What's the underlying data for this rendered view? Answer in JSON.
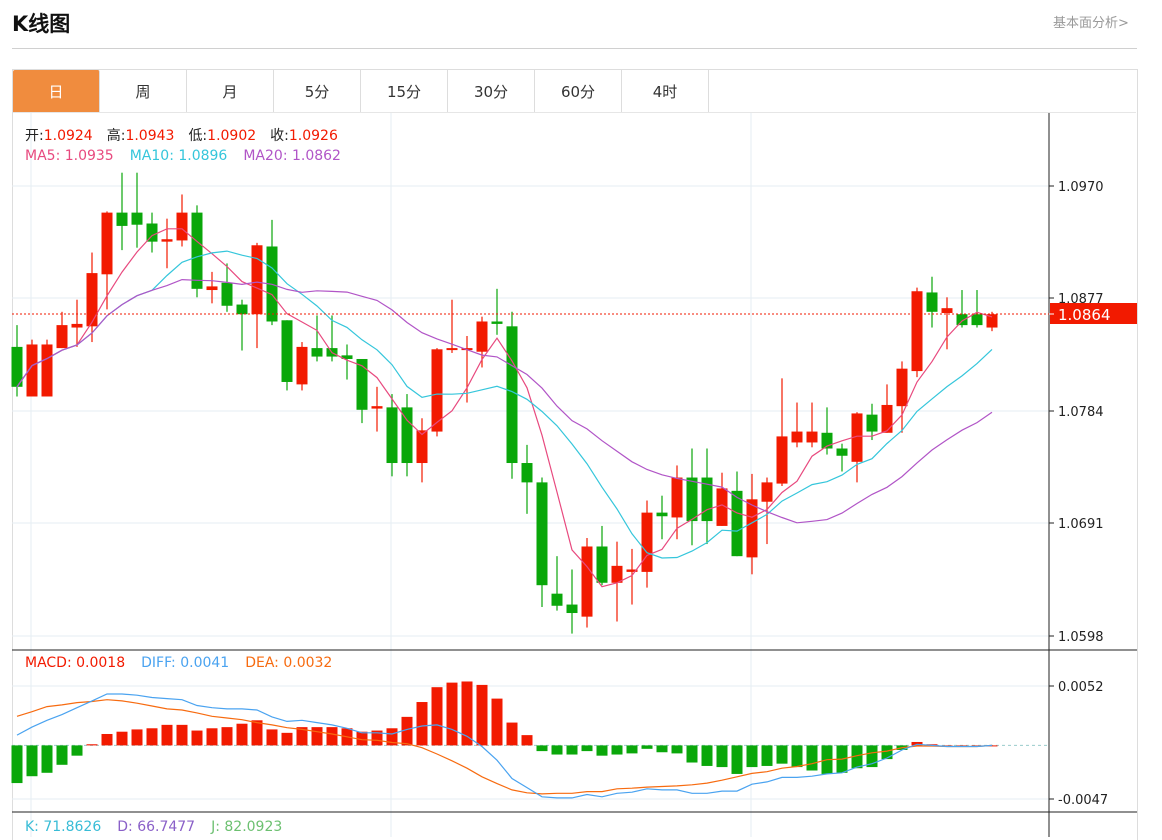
{
  "header": {
    "title": "K线图",
    "link": "基本面分析>"
  },
  "tabs": [
    {
      "label": "日",
      "active": true
    },
    {
      "label": "周"
    },
    {
      "label": "月"
    },
    {
      "label": "5分"
    },
    {
      "label": "15分"
    },
    {
      "label": "30分"
    },
    {
      "label": "60分"
    },
    {
      "label": "4时"
    }
  ],
  "ohlc_info": {
    "open_label": "开:",
    "open": "1.0924",
    "high_label": "高:",
    "high": "1.0943",
    "low_label": "低:",
    "low": "1.0902",
    "close_label": "收:",
    "close": "1.0926"
  },
  "ma_info": {
    "ma5": "MA5: 1.0935",
    "ma10": "MA10: 1.0896",
    "ma20": "MA20: 1.0862"
  },
  "macd_info": {
    "macd": "MACD: 0.0018",
    "diff": "DIFF: 0.0041",
    "dea": "DEA: 0.0032"
  },
  "kdj_info": {
    "k": "K: 71.8626",
    "d": "D: 66.7477",
    "j": "J: 82.0923"
  },
  "price_axis": {
    "ticks": [
      "1.0970",
      "1.0877",
      "1.0784",
      "1.0691",
      "1.0598"
    ],
    "current": "1.0864"
  },
  "macd_axis": {
    "ticks": [
      "0.0052",
      "-0.0047"
    ]
  },
  "colors": {
    "up": "#f21a00",
    "down": "#0aa70a",
    "ma5": "#e84a7f",
    "ma10": "#35c6db",
    "ma20": "#b155c7",
    "diff": "#4aa3f0",
    "dea": "#f76b10",
    "accent": "#f08c3e"
  },
  "chart_data": {
    "type": "candlestick",
    "ylim": [
      1.0598,
      1.097
    ],
    "ohlc": [
      [
        1.0837,
        1.0855,
        1.0796,
        1.0804
      ],
      [
        1.0796,
        1.0843,
        1.0796,
        1.0839
      ],
      [
        1.0796,
        1.0843,
        1.0796,
        1.0839
      ],
      [
        1.0836,
        1.0866,
        1.0836,
        1.0855
      ],
      [
        1.0853,
        1.0876,
        1.0837,
        1.0856
      ],
      [
        1.0854,
        1.0915,
        1.0841,
        1.0898
      ],
      [
        1.0897,
        1.0949,
        1.0868,
        1.0948
      ],
      [
        1.0948,
        1.0981,
        1.0917,
        1.0937
      ],
      [
        1.0948,
        1.0981,
        1.0919,
        1.0938
      ],
      [
        1.0939,
        1.0948,
        1.0915,
        1.0924
      ],
      [
        1.0924,
        1.0943,
        1.0902,
        1.0926
      ],
      [
        1.0925,
        1.0963,
        1.092,
        1.0948
      ],
      [
        1.0948,
        1.0954,
        1.0878,
        1.0885
      ],
      [
        1.0884,
        1.0899,
        1.0873,
        1.0887
      ],
      [
        1.089,
        1.0906,
        1.0866,
        1.0871
      ],
      [
        1.0872,
        1.0876,
        1.0834,
        1.0864
      ],
      [
        1.0864,
        1.0923,
        1.0836,
        1.0921
      ],
      [
        1.092,
        1.0942,
        1.0855,
        1.0858
      ],
      [
        1.0859,
        1.0859,
        1.0801,
        1.0808
      ],
      [
        1.0806,
        1.0841,
        1.0801,
        1.0837
      ],
      [
        1.0836,
        1.0863,
        1.0825,
        1.0829
      ],
      [
        1.0836,
        1.0863,
        1.0825,
        1.0829
      ],
      [
        1.083,
        1.0839,
        1.081,
        1.0827
      ],
      [
        1.0827,
        1.0827,
        1.0774,
        1.0785
      ],
      [
        1.0786,
        1.0804,
        1.0767,
        1.0788
      ],
      [
        1.0787,
        1.0798,
        1.073,
        1.0741
      ],
      [
        1.0787,
        1.0798,
        1.073,
        1.0741
      ],
      [
        1.0741,
        1.0778,
        1.0725,
        1.0768
      ],
      [
        1.0767,
        1.0836,
        1.0763,
        1.0835
      ],
      [
        1.0835,
        1.0876,
        1.0832,
        1.0836
      ],
      [
        1.0835,
        1.0846,
        1.0791,
        1.0836
      ],
      [
        1.0833,
        1.0862,
        1.082,
        1.0858
      ],
      [
        1.0858,
        1.0885,
        1.0847,
        1.0856
      ],
      [
        1.0854,
        1.0866,
        1.0728,
        1.0741
      ],
      [
        1.0741,
        1.0756,
        1.0699,
        1.0725
      ],
      [
        1.0725,
        1.0729,
        1.0622,
        1.064
      ],
      [
        1.0633,
        1.0664,
        1.0619,
        1.0623
      ],
      [
        1.0624,
        1.0653,
        1.06,
        1.0617
      ],
      [
        1.0614,
        1.0679,
        1.0605,
        1.0672
      ],
      [
        1.0672,
        1.0689,
        1.064,
        1.0642
      ],
      [
        1.0642,
        1.0676,
        1.061,
        1.0656
      ],
      [
        1.0651,
        1.067,
        1.0624,
        1.0653
      ],
      [
        1.0651,
        1.071,
        1.0638,
        1.07
      ],
      [
        1.07,
        1.0714,
        1.0678,
        1.0697
      ],
      [
        1.0696,
        1.0739,
        1.0678,
        1.0729
      ],
      [
        1.0729,
        1.0753,
        1.0673,
        1.0693
      ],
      [
        1.0729,
        1.0753,
        1.0674,
        1.0693
      ],
      [
        1.0689,
        1.0733,
        1.0689,
        1.072
      ],
      [
        1.0718,
        1.0734,
        1.0664,
        1.0664
      ],
      [
        1.0663,
        1.0732,
        1.0649,
        1.0711
      ],
      [
        1.0709,
        1.0729,
        1.0674,
        1.0725
      ],
      [
        1.0724,
        1.0811,
        1.0722,
        1.0763
      ],
      [
        1.0758,
        1.0791,
        1.0754,
        1.0767
      ],
      [
        1.0758,
        1.0791,
        1.0754,
        1.0767
      ],
      [
        1.0766,
        1.0787,
        1.0748,
        1.0753
      ],
      [
        1.0753,
        1.0757,
        1.0734,
        1.0747
      ],
      [
        1.0742,
        1.0783,
        1.0725,
        1.0782
      ],
      [
        1.0781,
        1.079,
        1.076,
        1.0767
      ],
      [
        1.0766,
        1.0806,
        1.0766,
        1.0789
      ],
      [
        1.0788,
        1.0825,
        1.0766,
        1.0819
      ],
      [
        1.0817,
        1.0886,
        1.0812,
        1.0883
      ],
      [
        1.0882,
        1.0895,
        1.0853,
        1.0866
      ],
      [
        1.0865,
        1.0878,
        1.0835,
        1.0869
      ],
      [
        1.0864,
        1.0884,
        1.0853,
        1.0855
      ],
      [
        1.0864,
        1.0884,
        1.0853,
        1.0855
      ],
      [
        1.0853,
        1.0866,
        1.085,
        1.0864
      ]
    ],
    "macd": {
      "ylim": [
        -0.0047,
        0.0052
      ],
      "hist": [
        -0.0033,
        -0.0027,
        -0.0024,
        -0.0017,
        -0.0009,
        0.0001,
        0.001,
        0.0012,
        0.0014,
        0.0015,
        0.0018,
        0.0018,
        0.0013,
        0.0015,
        0.0016,
        0.0019,
        0.0022,
        0.0014,
        0.0011,
        0.0016,
        0.0016,
        0.0016,
        0.0015,
        0.0012,
        0.0013,
        0.0015,
        0.0025,
        0.0038,
        0.0051,
        0.0055,
        0.0056,
        0.0053,
        0.0041,
        0.002,
        0.0009,
        -0.0005,
        -0.0008,
        -0.0008,
        -0.0005,
        -0.0009,
        -0.0008,
        -0.0007,
        -0.0003,
        -0.0006,
        -0.0007,
        -0.0015,
        -0.0018,
        -0.0019,
        -0.0025,
        -0.0019,
        -0.0018,
        -0.0016,
        -0.0019,
        -0.0022,
        -0.0025,
        -0.0024,
        -0.002,
        -0.0019,
        -0.0012,
        -0.0004,
        0.0003,
        0.0001,
        0.0,
        0.0,
        0.0,
        0.0
      ],
      "diff": [
        0.0009,
        0.0016,
        0.0022,
        0.0027,
        0.0033,
        0.0039,
        0.0045,
        0.0045,
        0.0044,
        0.0042,
        0.0041,
        0.004,
        0.0035,
        0.0033,
        0.0032,
        0.0032,
        0.0031,
        0.0025,
        0.0021,
        0.0022,
        0.002,
        0.0018,
        0.0015,
        0.0011,
        0.0011,
        0.001,
        0.0014,
        0.0017,
        0.0018,
        0.0014,
        0.0008,
        -0.0001,
        -0.0013,
        -0.0029,
        -0.0037,
        -0.0045,
        -0.0046,
        -0.0046,
        -0.0043,
        -0.0045,
        -0.0042,
        -0.0041,
        -0.0038,
        -0.0039,
        -0.0039,
        -0.0042,
        -0.0042,
        -0.004,
        -0.004,
        -0.0034,
        -0.0032,
        -0.0028,
        -0.0028,
        -0.0027,
        -0.0025,
        -0.0024,
        -0.0019,
        -0.0016,
        -0.0011,
        -0.0004,
        0.0001,
        0.0,
        -0.0001,
        -0.0001,
        -0.0001,
        0.0
      ]
    }
  }
}
